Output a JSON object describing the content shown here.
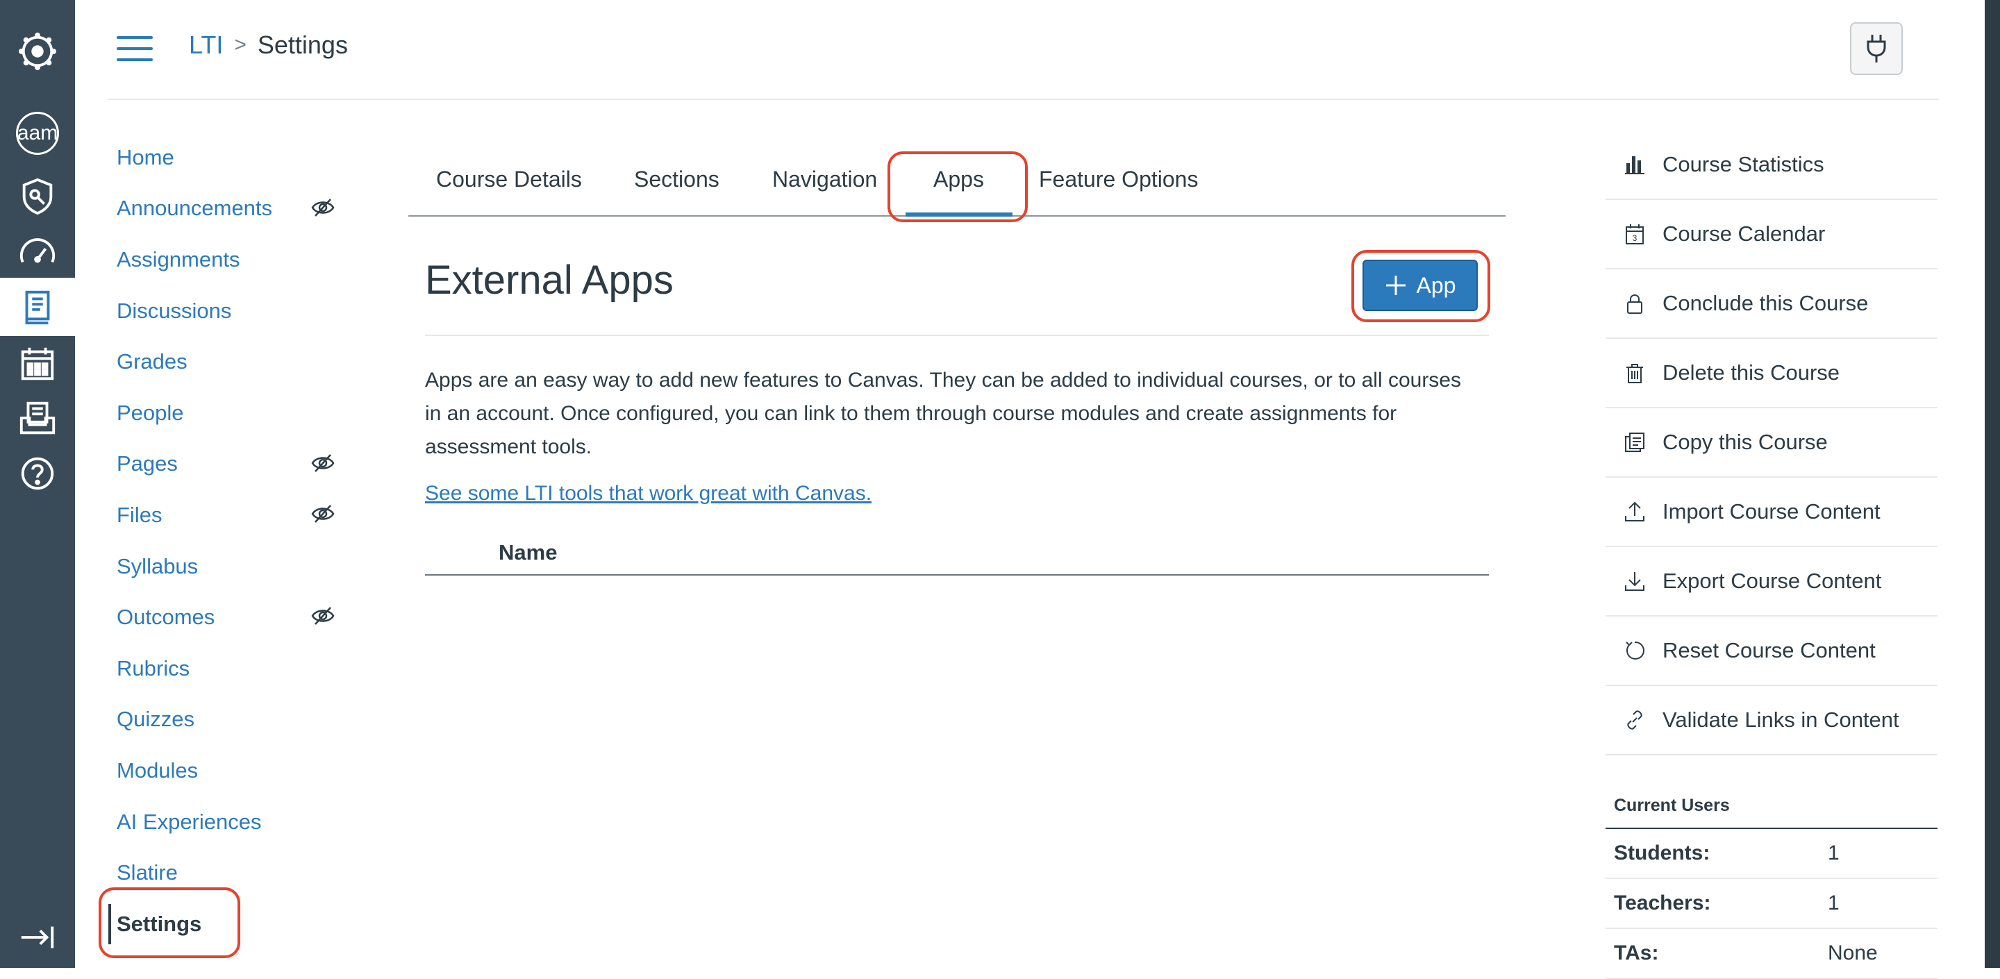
{
  "colors": {
    "rail_bg": "#394b58",
    "link": "#2b7abc",
    "text": "#2d3b45",
    "highlight": "#e8412c",
    "button": "#2b7abc"
  },
  "global_nav": {
    "items": [
      {
        "name": "logo",
        "icon": "canvas-logo-icon"
      },
      {
        "name": "account",
        "label": "aam",
        "icon": "avatar"
      },
      {
        "name": "admin",
        "icon": "shield-icon"
      },
      {
        "name": "dashboard",
        "icon": "speedometer-icon"
      },
      {
        "name": "courses",
        "icon": "book-icon",
        "active": true
      },
      {
        "name": "calendar",
        "icon": "calendar-icon"
      },
      {
        "name": "inbox",
        "icon": "inbox-icon"
      },
      {
        "name": "help",
        "icon": "question-icon"
      }
    ],
    "collapse_icon": "collapse-arrow-icon"
  },
  "header": {
    "breadcrumb_course": "LTI",
    "breadcrumb_separator": ">",
    "breadcrumb_current": "Settings",
    "plugin_icon": "plug-icon"
  },
  "course_nav": {
    "items": [
      {
        "label": "Home",
        "hidden": false
      },
      {
        "label": "Announcements",
        "hidden": true
      },
      {
        "label": "Assignments",
        "hidden": false
      },
      {
        "label": "Discussions",
        "hidden": false
      },
      {
        "label": "Grades",
        "hidden": false
      },
      {
        "label": "People",
        "hidden": false
      },
      {
        "label": "Pages",
        "hidden": true
      },
      {
        "label": "Files",
        "hidden": true
      },
      {
        "label": "Syllabus",
        "hidden": false
      },
      {
        "label": "Outcomes",
        "hidden": true
      },
      {
        "label": "Rubrics",
        "hidden": false
      },
      {
        "label": "Quizzes",
        "hidden": false
      },
      {
        "label": "Modules",
        "hidden": false
      },
      {
        "label": "AI Experiences",
        "hidden": false
      },
      {
        "label": "Slatire",
        "hidden": false
      },
      {
        "label": "Settings",
        "hidden": false,
        "active": true
      }
    ]
  },
  "tabs": [
    {
      "label": "Course Details"
    },
    {
      "label": "Sections"
    },
    {
      "label": "Navigation"
    },
    {
      "label": "Apps",
      "active": true
    },
    {
      "label": "Feature Options"
    }
  ],
  "main": {
    "title": "External Apps",
    "add_button_label": "App",
    "description": "Apps are an easy way to add new features to Canvas. They can be added to individual courses, or to all courses in an account. Once configured, you can link to them through course modules and create assignments for assessment tools.",
    "link_text": "See some LTI tools that work great with Canvas.",
    "table_header_name": "Name"
  },
  "sidebar": {
    "items": [
      {
        "label": "Course Statistics",
        "icon": "bar-chart-icon"
      },
      {
        "label": "Course Calendar",
        "icon": "calendar-icon"
      },
      {
        "label": "Conclude this Course",
        "icon": "lock-icon"
      },
      {
        "label": "Delete this Course",
        "icon": "trash-icon"
      },
      {
        "label": "Copy this Course",
        "icon": "copy-icon"
      },
      {
        "label": "Import Course Content",
        "icon": "upload-icon"
      },
      {
        "label": "Export Course Content",
        "icon": "download-icon"
      },
      {
        "label": "Reset Course Content",
        "icon": "reset-icon"
      },
      {
        "label": "Validate Links in Content",
        "icon": "link-icon"
      }
    ],
    "current_users_title": "Current Users",
    "current_users": [
      {
        "label": "Students:",
        "value": "1"
      },
      {
        "label": "Teachers:",
        "value": "1"
      },
      {
        "label": "TAs:",
        "value": "None"
      }
    ]
  }
}
